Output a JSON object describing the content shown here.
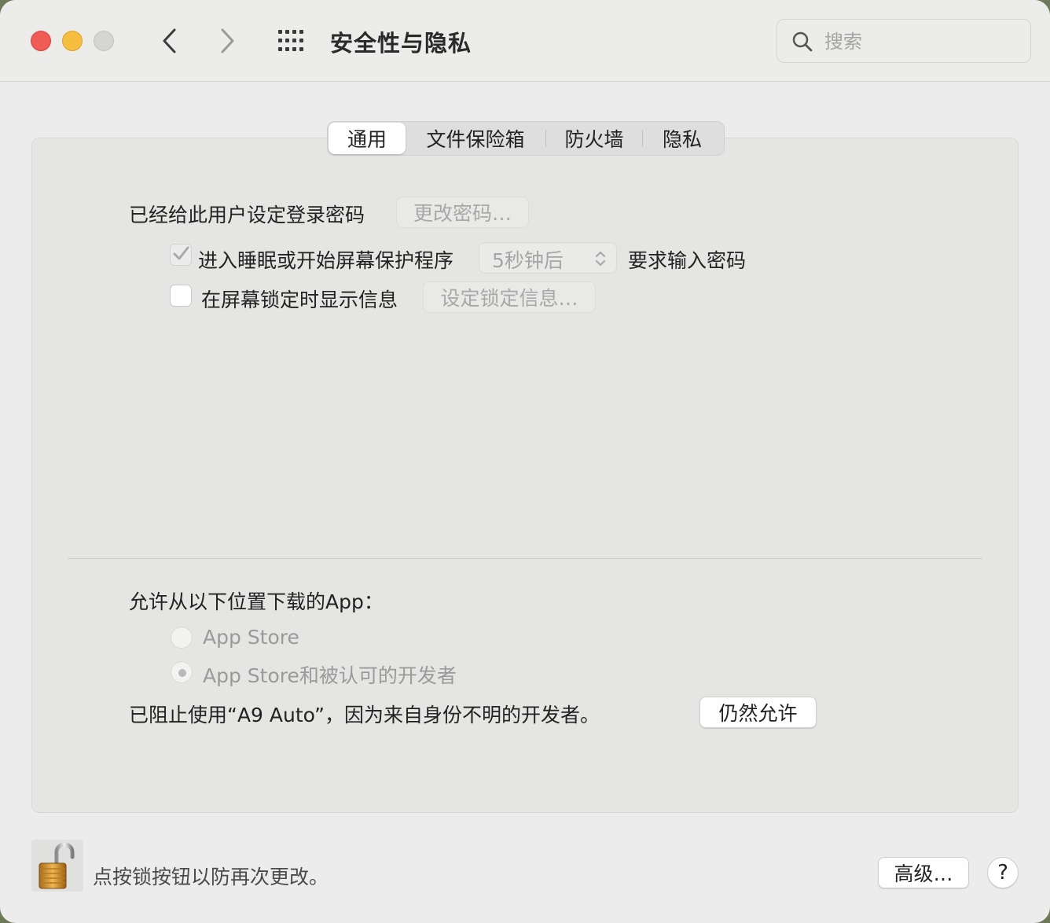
{
  "window": {
    "title": "安全性与隐私",
    "search_placeholder": "搜索"
  },
  "tabs": [
    {
      "label": "通用",
      "active": true
    },
    {
      "label": "文件保险箱",
      "active": false
    },
    {
      "label": "防火墙",
      "active": false
    },
    {
      "label": "隐私",
      "active": false
    }
  ],
  "general": {
    "password_set_label": "已经给此用户设定登录密码",
    "change_password_button": "更改密码…",
    "require_password": {
      "checked": true,
      "prefix_label": "进入睡眠或开始屏幕保护程序",
      "delay_value": "5秒钟后",
      "suffix_label": "要求输入密码"
    },
    "lock_message": {
      "checked": false,
      "label": "在屏幕锁定时显示信息",
      "button": "设定锁定信息…"
    }
  },
  "downloads": {
    "heading": "允许从以下位置下载的App：",
    "options": [
      {
        "label": "App Store",
        "selected": false
      },
      {
        "label": "App Store和被认可的开发者",
        "selected": true
      }
    ],
    "blocked_message": "已阻止使用“A9 Auto”，因为来自身份不明的开发者。",
    "allow_anyway_button": "仍然允许"
  },
  "footer": {
    "lock_message": "点按锁按钮以防再次更改。",
    "advanced_button": "高级…",
    "help_button": "?"
  },
  "colors": {
    "close": "#ee5c55",
    "minimize": "#f5be3f",
    "zoom_disabled": "#d5d5d3"
  }
}
